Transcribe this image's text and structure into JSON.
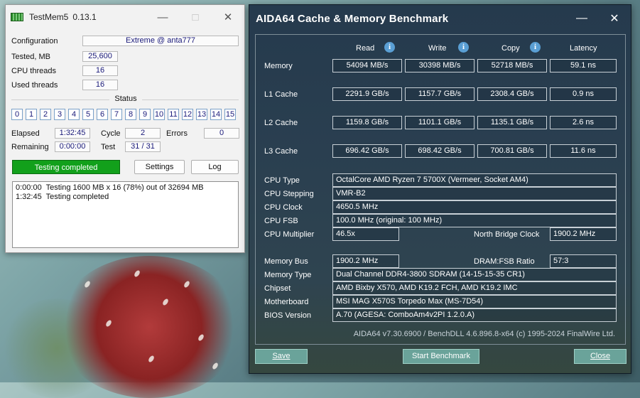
{
  "testmem": {
    "app_name": "TestMem5",
    "version": "0.13.1",
    "configuration_label": "Configuration",
    "configuration_value": "Extreme @ anta777",
    "tested_label": "Tested, MB",
    "tested_value": "25,600",
    "cpu_threads_label": "CPU threads",
    "cpu_threads_value": "16",
    "used_threads_label": "Used threads",
    "used_threads_value": "16",
    "status_label": "Status",
    "status_boxes": [
      "0",
      "1",
      "2",
      "3",
      "4",
      "5",
      "6",
      "7",
      "8",
      "9",
      "10",
      "11",
      "12",
      "13",
      "14",
      "15"
    ],
    "elapsed_label": "Elapsed",
    "elapsed_value": "1:32:45",
    "cycle_label": "Cycle",
    "cycle_value": "2",
    "errors_label": "Errors",
    "errors_value": "0",
    "remaining_label": "Remaining",
    "remaining_value": "0:00:00",
    "test_label": "Test",
    "test_value": "31 / 31",
    "result_text": "Testing completed",
    "settings_label": "Settings",
    "log_label": "Log",
    "log_lines": [
      "0:00:00  Testing 1600 MB x 16 (78%) out of 32694 MB",
      "1:32:45  Testing completed"
    ]
  },
  "aida": {
    "title": "AIDA64 Cache & Memory Benchmark",
    "columns": [
      "Read",
      "Write",
      "Copy",
      "Latency"
    ],
    "rows": [
      {
        "label": "Memory",
        "values": [
          "54094 MB/s",
          "30398 MB/s",
          "52718 MB/s",
          "59.1 ns"
        ]
      },
      {
        "label": "L1 Cache",
        "values": [
          "2291.9 GB/s",
          "1157.7 GB/s",
          "2308.4 GB/s",
          "0.9 ns"
        ]
      },
      {
        "label": "L2 Cache",
        "values": [
          "1159.8 GB/s",
          "1101.1 GB/s",
          "1135.1 GB/s",
          "2.6 ns"
        ]
      },
      {
        "label": "L3 Cache",
        "values": [
          "696.42 GB/s",
          "698.42 GB/s",
          "700.81 GB/s",
          "11.6 ns"
        ]
      }
    ],
    "cpu_type_label": "CPU Type",
    "cpu_type": "OctalCore AMD Ryzen 7 5700X  (Vermeer, Socket AM4)",
    "cpu_stepping_label": "CPU Stepping",
    "cpu_stepping": "VMR-B2",
    "cpu_clock_label": "CPU Clock",
    "cpu_clock": "4650.5 MHz",
    "cpu_fsb_label": "CPU FSB",
    "cpu_fsb": "100.0 MHz  (original: 100 MHz)",
    "cpu_multiplier_label": "CPU Multiplier",
    "cpu_multiplier": "46.5x",
    "nb_clock_label": "North Bridge Clock",
    "nb_clock": "1900.2 MHz",
    "memory_bus_label": "Memory Bus",
    "memory_bus": "1900.2 MHz",
    "dram_fsb_label": "DRAM:FSB Ratio",
    "dram_fsb": "57:3",
    "memory_type_label": "Memory Type",
    "memory_type": "Dual Channel DDR4-3800 SDRAM  (14-15-15-35 CR1)",
    "chipset_label": "Chipset",
    "chipset": "AMD Bixby X570, AMD K19.2 FCH, AMD K19.2 IMC",
    "motherboard_label": "Motherboard",
    "motherboard": "MSI MAG X570S Torpedo Max (MS-7D54)",
    "bios_label": "BIOS Version",
    "bios": "A.70  (AGESA: ComboAm4v2PI 1.2.0.A)",
    "footer": "AIDA64 v7.30.6900 / BenchDLL 4.6.896.8-x64  (c) 1995-2024 FinalWire Ltd.",
    "save_label": "Save",
    "start_label": "Start Benchmark",
    "close_label": "Close"
  }
}
